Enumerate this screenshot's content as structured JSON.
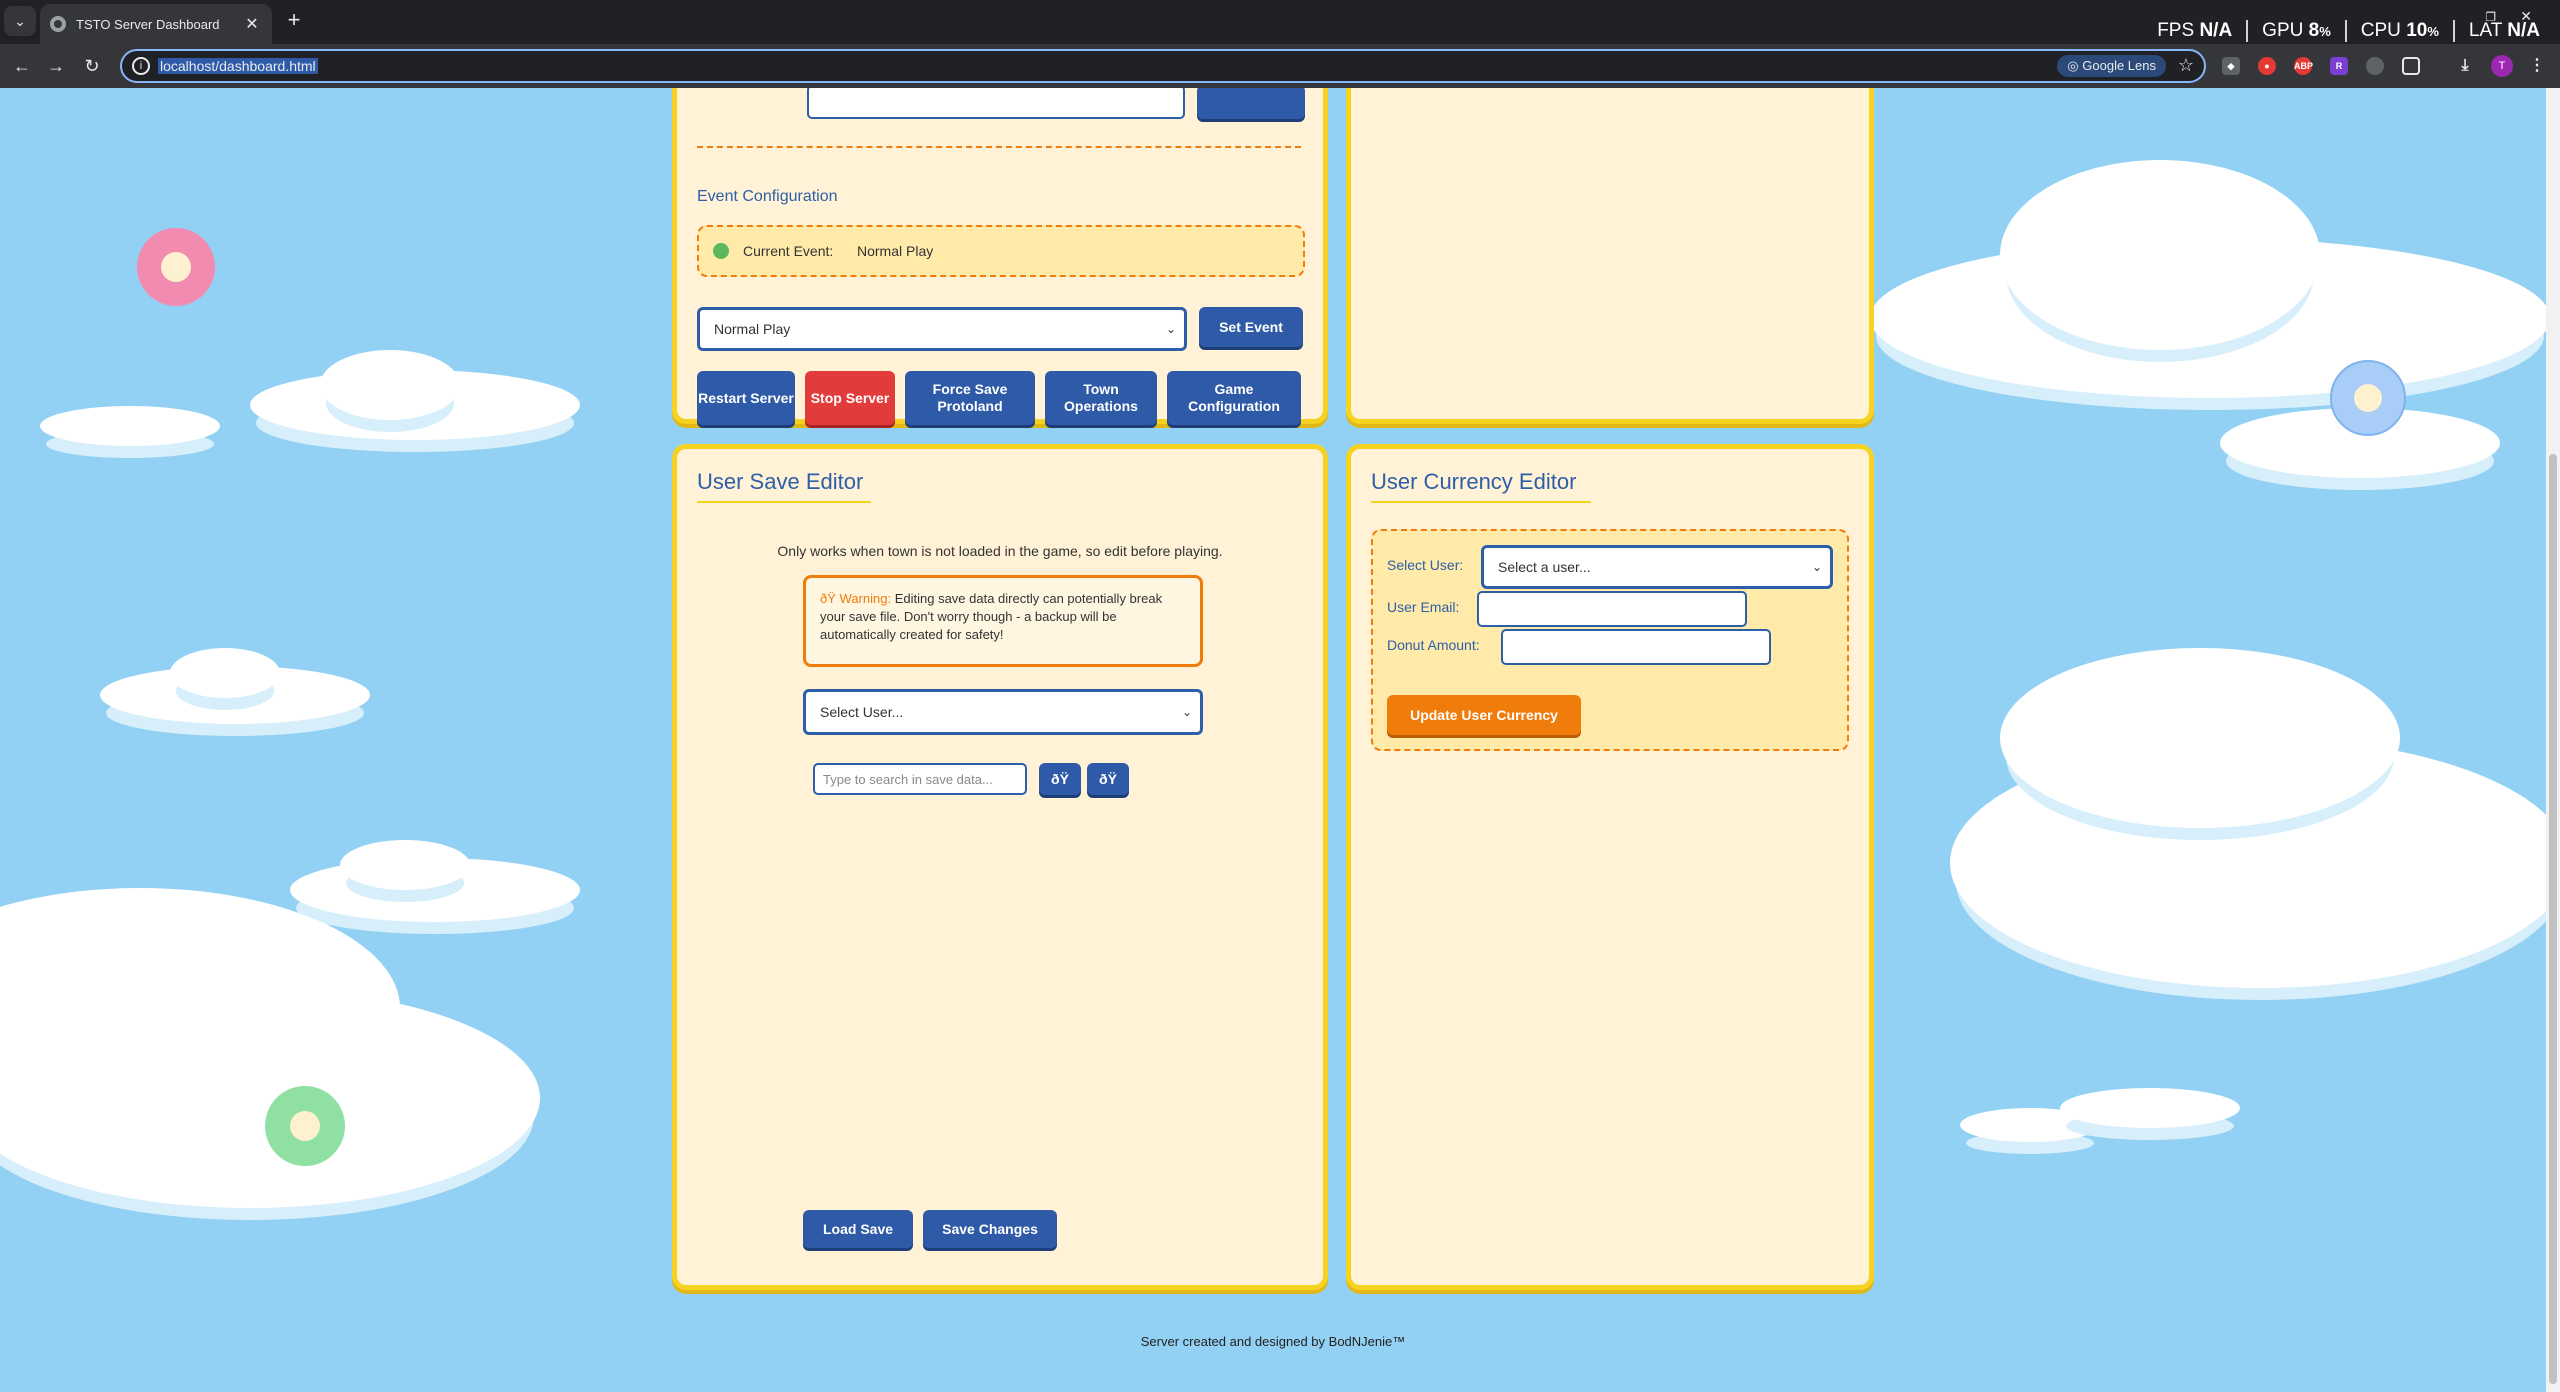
{
  "browser": {
    "tab_title": "TSTO Server Dashboard",
    "tab_close": "✕",
    "new_tab": "+",
    "url": "localhost/dashboard.html",
    "lens_label": "Google Lens",
    "profile_initial": "T",
    "extensions": [
      "shield",
      "record",
      "ABP",
      "R",
      "puzzle"
    ],
    "nav": {
      "back": "←",
      "forward": "→",
      "reload": "↻"
    }
  },
  "stats": {
    "fps_label": "FPS",
    "fps_value": "N/A",
    "gpu_label": "GPU",
    "gpu_value": "8",
    "gpu_unit": "%",
    "cpu_label": "CPU",
    "cpu_value": "10",
    "cpu_unit": "%",
    "lat_label": "LAT",
    "lat_value": "N/A"
  },
  "server_panel": {
    "event_config_title": "Event Configuration",
    "current_event_label": "Current Event:",
    "current_event_value": "Normal Play",
    "event_select_value": "Normal Play",
    "set_event_button": "Set Event",
    "buttons": {
      "restart": "Restart Server",
      "stop": "Stop Server",
      "force_save": "Force Save Protoland",
      "town_ops": "Town Operations",
      "game_config": "Game Configuration"
    }
  },
  "save_editor": {
    "title": "User Save Editor",
    "note": "Only works when town is not loaded in the game, so edit before playing.",
    "warning_icon": "ðŸ",
    "warning_label": "Warning:",
    "warning_text": "Editing save data directly can potentially break your save file. Don't worry though - a backup will be automatically created for safety!",
    "select_user": "Select User...",
    "search_placeholder": "Type to search in save data...",
    "search_btn_1": "ðŸ",
    "search_btn_2": "ðŸ",
    "load_button": "Load Save",
    "save_button": "Save Changes"
  },
  "currency_editor": {
    "title": "User Currency Editor",
    "select_user_label": "Select User:",
    "select_user_value": "Select a user...",
    "email_label": "User Email:",
    "donut_label": "Donut Amount:",
    "update_button": "Update User Currency"
  },
  "footer": {
    "text": "Server created and designed by BodNJenie™"
  },
  "colors": {
    "sky": "#92d1f4",
    "card_bg": "#fff2d6",
    "card_border": "#f7d321",
    "primary_blue": "#2f5aa7",
    "danger_red": "#e23b3b",
    "accent_orange": "#f07c0c",
    "status_green": "#5cb85c"
  }
}
